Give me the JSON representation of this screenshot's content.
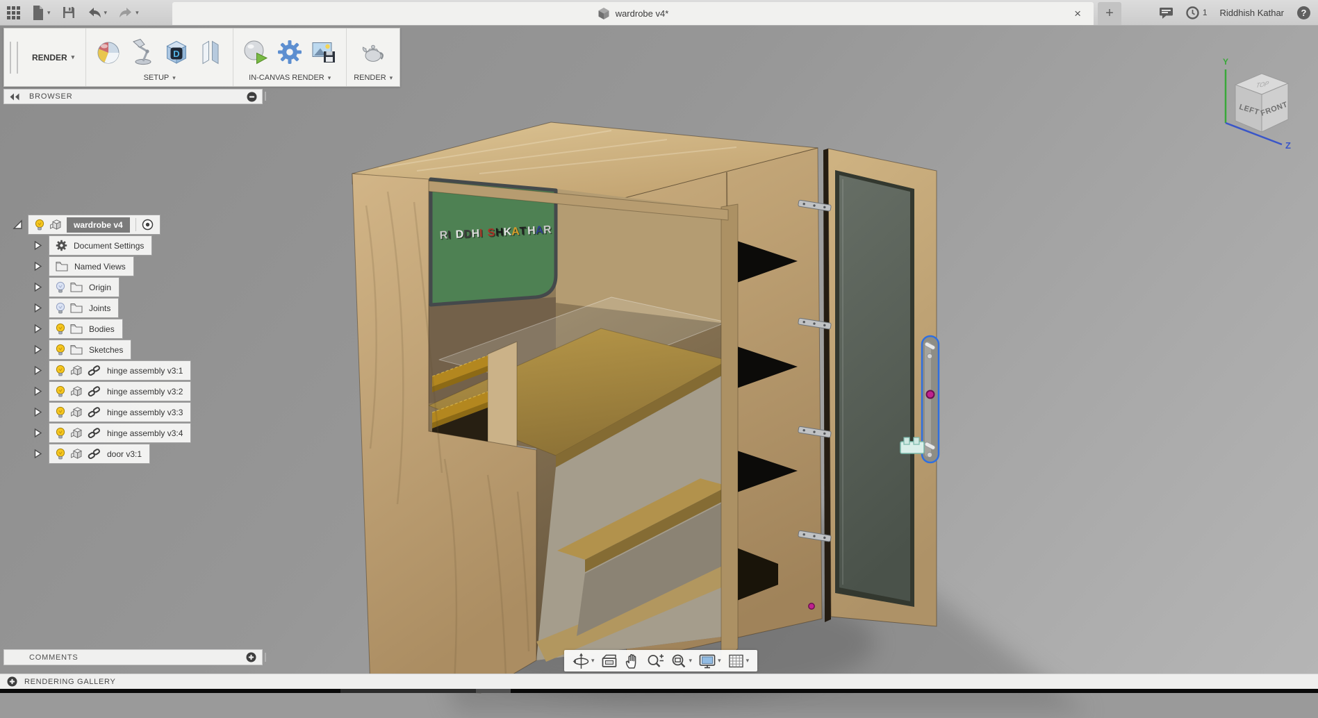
{
  "app_bar": {
    "left_icons": [
      "app-grid-icon",
      "new-file-icon",
      "save-icon",
      "undo-icon",
      "redo-icon"
    ],
    "tab": {
      "title": "wardrobe v4*",
      "close_glyph": "×"
    },
    "new_tab_glyph": "+",
    "notification_count": "1",
    "user_name": "Riddhish Kathar"
  },
  "toolbar": {
    "workspace_label": "RENDER",
    "groups": [
      {
        "label": "SETUP",
        "icons": [
          "appearance-icon",
          "scene-settings-icon",
          "decal-icon",
          "texture-icon"
        ]
      },
      {
        "label": "IN-CANVAS RENDER",
        "icons": [
          "in-canvas-render-icon",
          "render-settings-icon",
          "capture-image-icon"
        ]
      },
      {
        "label": "RENDER",
        "icons": [
          "render-teapot-icon"
        ]
      }
    ]
  },
  "browser": {
    "title": "BROWSER",
    "rows": [
      {
        "label": "wardrobe v4",
        "expander": "expanded",
        "icons": [
          "bulb-on-icon",
          "component-icon"
        ],
        "selected": true,
        "trailing": "radio-icon"
      },
      {
        "label": "Document Settings",
        "expander": "collapsed",
        "icons": [
          "gear-icon"
        ]
      },
      {
        "label": "Named Views",
        "expander": "collapsed",
        "icons": [
          "folder-icon"
        ]
      },
      {
        "label": "Origin",
        "expander": "collapsed",
        "icons": [
          "bulb-off-icon",
          "folder-icon"
        ]
      },
      {
        "label": "Joints",
        "expander": "collapsed",
        "icons": [
          "bulb-off-icon",
          "folder-icon"
        ]
      },
      {
        "label": "Bodies",
        "expander": "collapsed",
        "icons": [
          "bulb-on-icon",
          "folder-icon"
        ]
      },
      {
        "label": "Sketches",
        "expander": "collapsed",
        "icons": [
          "bulb-on-icon",
          "folder-icon"
        ]
      },
      {
        "label": "hinge assembly v3:1",
        "expander": "collapsed",
        "icons": [
          "bulb-on-icon",
          "component-icon",
          "link-icon"
        ]
      },
      {
        "label": "hinge assembly v3:2",
        "expander": "collapsed",
        "icons": [
          "bulb-on-icon",
          "component-icon",
          "link-icon"
        ]
      },
      {
        "label": "hinge assembly v3:3",
        "expander": "collapsed",
        "icons": [
          "bulb-on-icon",
          "component-icon",
          "link-icon"
        ]
      },
      {
        "label": "hinge assembly v3:4",
        "expander": "collapsed",
        "icons": [
          "bulb-on-icon",
          "component-icon",
          "link-icon"
        ]
      },
      {
        "label": "door v3:1",
        "expander": "collapsed",
        "icons": [
          "bulb-on-icon",
          "component-icon",
          "link-icon"
        ]
      }
    ]
  },
  "viewcube": {
    "faces": {
      "top": "TOP",
      "left": "LEFT",
      "front": "FRONT"
    },
    "axes": {
      "y": "Y",
      "z": "Z"
    }
  },
  "nav_bar": {
    "icons": [
      {
        "name": "orbit-icon",
        "caret": true
      },
      {
        "name": "look-at-icon",
        "caret": false
      },
      {
        "name": "pan-icon",
        "caret": false
      },
      {
        "name": "zoom-icon",
        "caret": false
      },
      {
        "name": "fit-icon",
        "caret": true
      },
      {
        "name": "display-settings-icon",
        "caret": true
      },
      {
        "name": "grid-layout-icon",
        "caret": true
      }
    ]
  },
  "comments_panel": {
    "title": "COMMENTS"
  },
  "status_bar": {
    "label": "RENDERING GALLERY"
  },
  "model": {
    "board_color": "#4e8153",
    "mirror_color": "#59615a",
    "selection_outline_color": "#2f6fe0",
    "joint_marker_color": "#c0218f",
    "board_letters": [
      {
        "ch": "R",
        "color": "#c7c7c7"
      },
      {
        "ch": "I",
        "color": "#2f2f2f"
      },
      {
        "ch": "D",
        "color": "#e8e8e8"
      },
      {
        "ch": "D",
        "color": "#3c3c3c"
      },
      {
        "ch": "H",
        "color": "#dcdcdc"
      },
      {
        "ch": "I",
        "color": "#a83226"
      },
      {
        "ch": "S",
        "color": "#a83226"
      },
      {
        "ch": "H",
        "color": "#181818"
      },
      {
        "ch": "K",
        "color": "#e4e4e4"
      },
      {
        "ch": "A",
        "color": "#d89d2b"
      },
      {
        "ch": "T",
        "color": "#1f1f1f"
      },
      {
        "ch": "H",
        "color": "#dadada"
      },
      {
        "ch": "A",
        "color": "#31418f"
      },
      {
        "ch": "R",
        "color": "#c9c9c9"
      }
    ]
  }
}
